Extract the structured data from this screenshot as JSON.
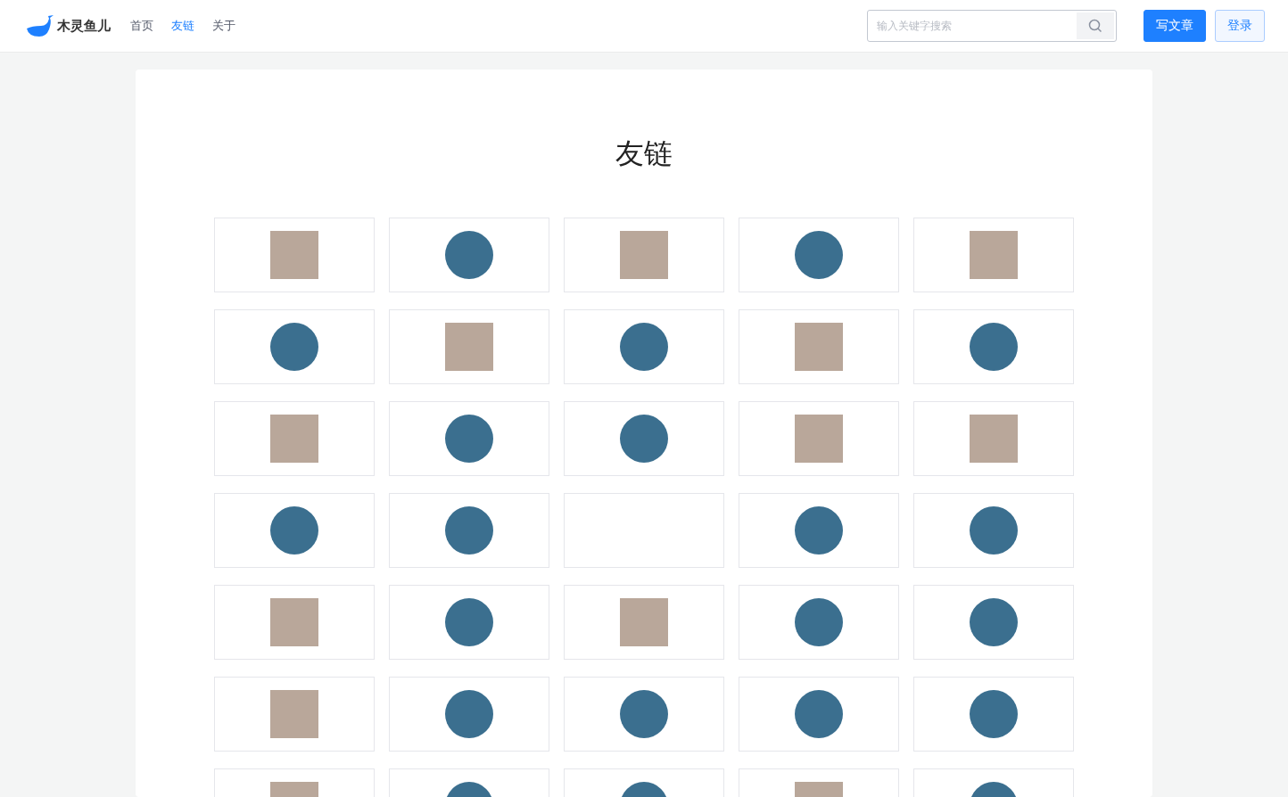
{
  "header": {
    "logo_text": "木灵鱼儿",
    "nav": [
      {
        "label": "首页",
        "selected": false
      },
      {
        "label": "友链",
        "selected": true
      },
      {
        "label": "关于",
        "selected": false
      }
    ],
    "search": {
      "placeholder": "输入关键字搜索"
    },
    "buttons": [
      {
        "label": "写文章",
        "kind": "primary"
      },
      {
        "label": "登录",
        "kind": "plain"
      }
    ]
  },
  "page": {
    "title": "友链",
    "links": [
      {
        "kind": "photo"
      },
      {
        "kind": "logo"
      },
      {
        "kind": "photo"
      },
      {
        "kind": "logo"
      },
      {
        "kind": "photo"
      },
      {
        "kind": "logo"
      },
      {
        "kind": "photo"
      },
      {
        "kind": "logo"
      },
      {
        "kind": "photo"
      },
      {
        "kind": "logo"
      },
      {
        "kind": "photo"
      },
      {
        "kind": "logo"
      },
      {
        "kind": "logo"
      },
      {
        "kind": "photo"
      },
      {
        "kind": "photo"
      },
      {
        "kind": "logo"
      },
      {
        "kind": "logo"
      },
      {
        "kind": "none"
      },
      {
        "kind": "logo"
      },
      {
        "kind": "logo"
      },
      {
        "kind": "photo"
      },
      {
        "kind": "logo"
      },
      {
        "kind": "photo"
      },
      {
        "kind": "logo"
      },
      {
        "kind": "logo"
      },
      {
        "kind": "photo"
      },
      {
        "kind": "logo"
      },
      {
        "kind": "logo"
      },
      {
        "kind": "logo"
      },
      {
        "kind": "logo"
      },
      {
        "kind": "photo"
      },
      {
        "kind": "logo"
      },
      {
        "kind": "logo"
      },
      {
        "kind": "photo"
      },
      {
        "kind": "logo"
      }
    ]
  }
}
